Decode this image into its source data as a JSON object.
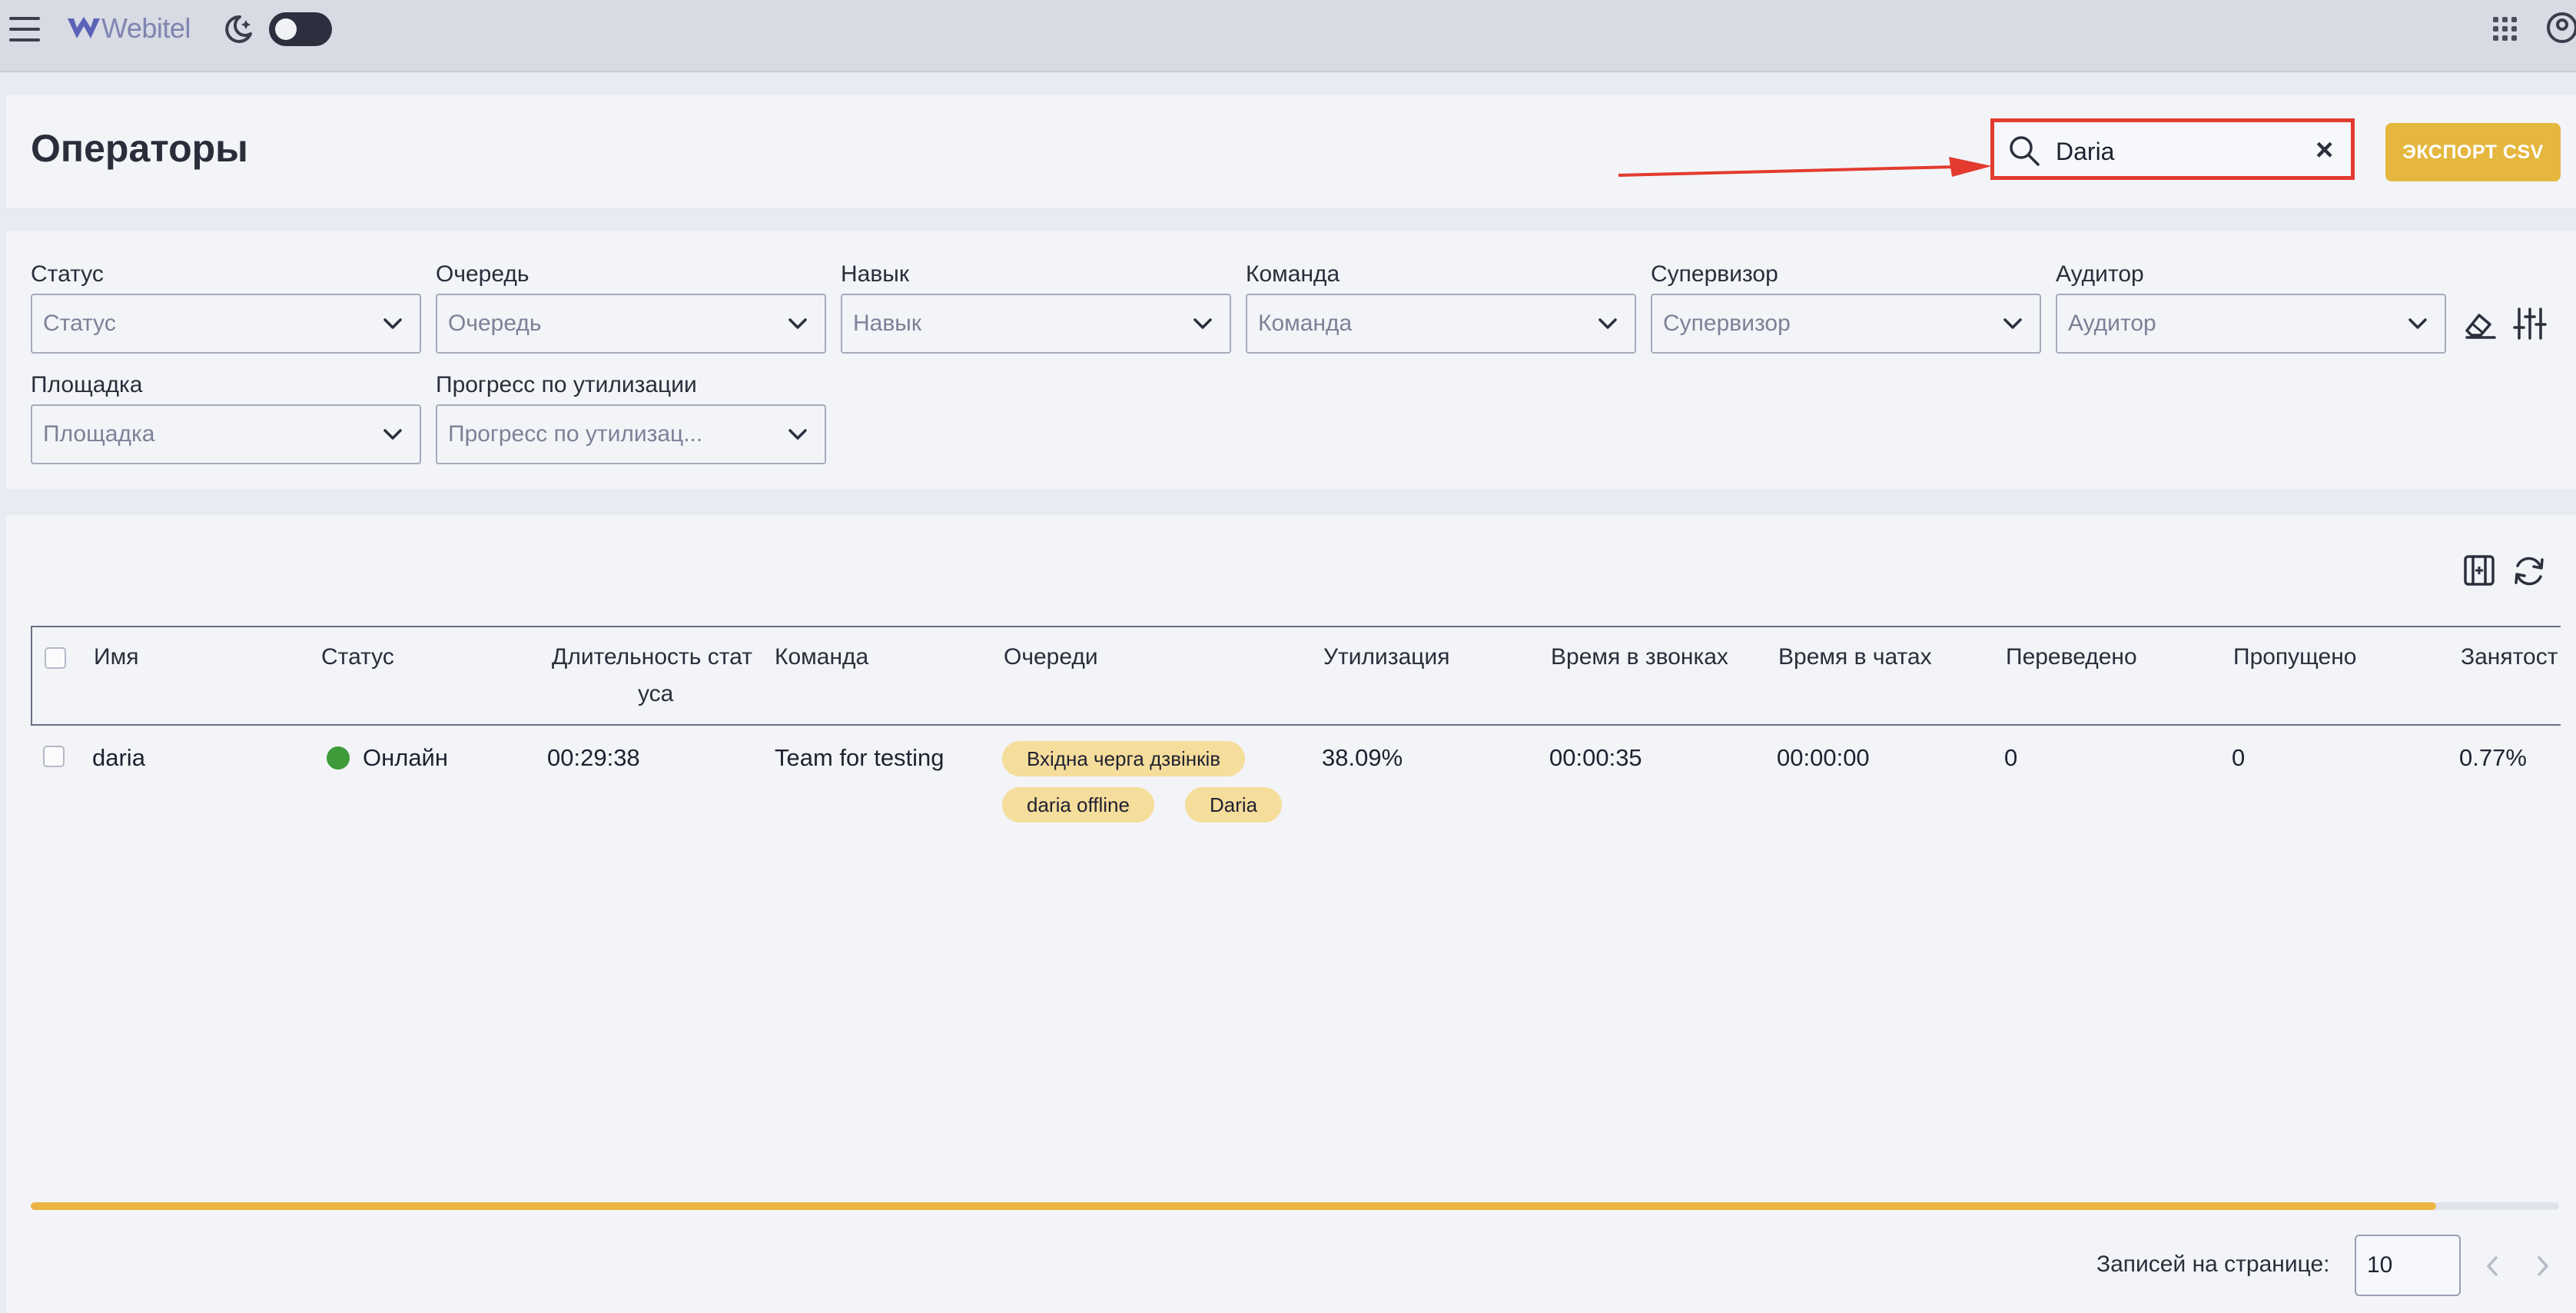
{
  "app": {
    "logo_text": "Webitel"
  },
  "header": {
    "title": "Операторы"
  },
  "search": {
    "value": "Daria",
    "clear_symbol": "×"
  },
  "export_button": {
    "label": "ЭКСПОРТ CSV"
  },
  "filters": [
    {
      "label": "Статус",
      "placeholder": "Статус"
    },
    {
      "label": "Очередь",
      "placeholder": "Очередь"
    },
    {
      "label": "Навык",
      "placeholder": "Навык"
    },
    {
      "label": "Команда",
      "placeholder": "Команда"
    },
    {
      "label": "Супервизор",
      "placeholder": "Супервизор"
    },
    {
      "label": "Аудитор",
      "placeholder": "Аудитор"
    },
    {
      "label": "Площадка",
      "placeholder": "Площадка"
    },
    {
      "label": "Прогресс по утилизации",
      "placeholder": "Прогресс по утилизац..."
    }
  ],
  "table": {
    "columns": [
      "Имя",
      "Статус",
      "Длительность стат",
      "уса",
      "Команда",
      "Очереди",
      "Утилизация",
      "Время в звонках",
      "Время в чатах",
      "Переведено",
      "Пропущено",
      "Занятост"
    ],
    "rows": [
      {
        "name": "daria",
        "status": "Онлайн",
        "status_color": "#3d9b3a",
        "duration": "00:29:38",
        "team": "Team for testing",
        "queues": [
          "Вхідна черга дзвінків",
          "daria offline",
          "Daria"
        ],
        "utilization": "38.09%",
        "call_time": "00:00:35",
        "chat_time": "00:00:00",
        "transferred": "0",
        "missed": "0",
        "occupancy": "0.77%"
      }
    ]
  },
  "pagination": {
    "label": "Записей на странице:",
    "per_page": "10"
  },
  "colors": {
    "accent": "#e5b73f",
    "highlight": "#e33b2f",
    "chip": "#f5dd9c"
  },
  "icons": [
    "menu-icon",
    "moon-icon",
    "apps-grid-icon",
    "user-icon",
    "search-icon",
    "eraser-icon",
    "filter-settings-icon",
    "expand-columns-icon",
    "refresh-icon",
    "chevron-down-icon",
    "chevron-left-icon",
    "chevron-right-icon"
  ]
}
